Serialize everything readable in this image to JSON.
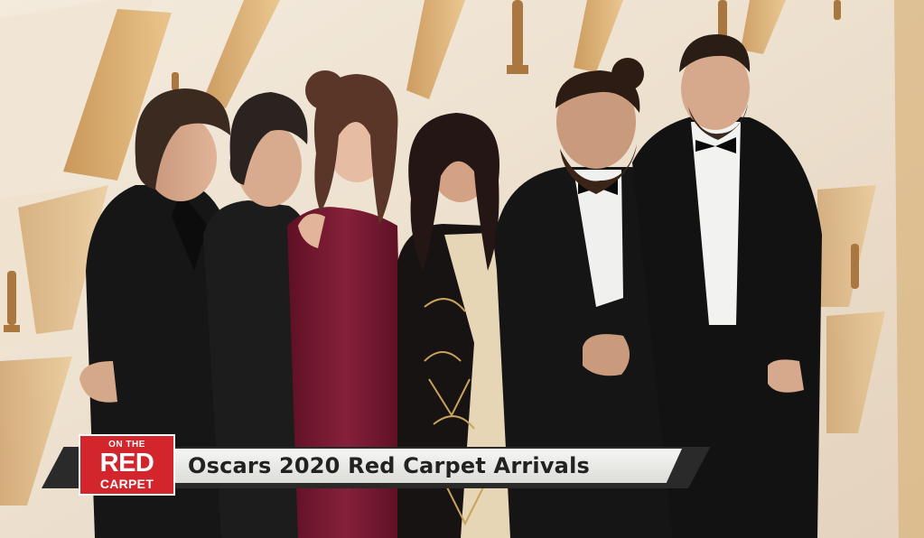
{
  "broadcast": {
    "show_logo": {
      "line1": "ON THE",
      "line2": "RED",
      "line3": "CARPET"
    },
    "headline": "Oscars 2020 Red Carpet Arrivals"
  },
  "colors": {
    "logo_red": "#d2262c",
    "title_bar_light": "#f2f2f0",
    "title_bar_dark": "#2a2a2a",
    "backdrop_cream": "#eee3d3",
    "backdrop_gold": "#d9a864",
    "dress_burgundy": "#7a1a32",
    "tuxedo_black": "#141414"
  },
  "scene": {
    "subject_count": 6,
    "setting": "Oscar statuette backdrop wall"
  }
}
